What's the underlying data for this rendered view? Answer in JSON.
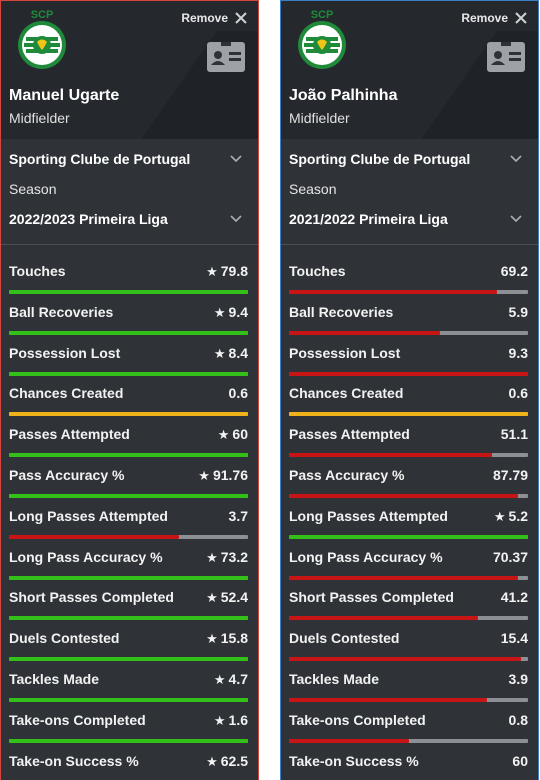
{
  "colors": {
    "green": "#33c019",
    "red": "#c71414",
    "yellow": "#f0b21a",
    "gray_track": "#8c8f93",
    "left_border": "#d8453e",
    "right_border": "#3d7fc4"
  },
  "players": [
    {
      "remove_label": "Remove",
      "logo_icon": "sporting-cp-crest-icon",
      "name": "Manuel Ugarte",
      "position": "Midfielder",
      "club": "Sporting Clube de Portugal",
      "season_label": "Season",
      "season": "2022/2023 Primeira Liga",
      "stats": [
        {
          "label": "Touches",
          "value": "79.8",
          "star": true,
          "fill": 1.0,
          "color": "green"
        },
        {
          "label": "Ball Recoveries",
          "value": "9.4",
          "star": true,
          "fill": 1.0,
          "color": "green"
        },
        {
          "label": "Possession Lost",
          "value": "8.4",
          "star": true,
          "fill": 1.0,
          "color": "green"
        },
        {
          "label": "Chances Created",
          "value": "0.6",
          "star": false,
          "fill": 1.0,
          "color": "yellow"
        },
        {
          "label": "Passes Attempted",
          "value": "60",
          "star": true,
          "fill": 1.0,
          "color": "green"
        },
        {
          "label": "Pass Accuracy %",
          "value": "91.76",
          "star": true,
          "fill": 1.0,
          "color": "green"
        },
        {
          "label": "Long Passes Attempted",
          "value": "3.7",
          "star": false,
          "fill": 0.71,
          "color": "red"
        },
        {
          "label": "Long Pass Accuracy %",
          "value": "73.2",
          "star": true,
          "fill": 1.0,
          "color": "green"
        },
        {
          "label": "Short Passes Completed",
          "value": "52.4",
          "star": true,
          "fill": 1.0,
          "color": "green"
        },
        {
          "label": "Duels Contested",
          "value": "15.8",
          "star": true,
          "fill": 1.0,
          "color": "green"
        },
        {
          "label": "Tackles Made",
          "value": "4.7",
          "star": true,
          "fill": 1.0,
          "color": "green"
        },
        {
          "label": "Take-ons Completed",
          "value": "1.6",
          "star": true,
          "fill": 1.0,
          "color": "green"
        },
        {
          "label": "Take-on Success %",
          "value": "62.5",
          "star": true,
          "fill": 1.0,
          "color": "green"
        }
      ]
    },
    {
      "remove_label": "Remove",
      "logo_icon": "sporting-cp-crest-icon",
      "name": "João Palhinha",
      "position": "Midfielder",
      "club": "Sporting Clube de Portugal",
      "season_label": "Season",
      "season": "2021/2022 Primeira Liga",
      "stats": [
        {
          "label": "Touches",
          "value": "69.2",
          "star": false,
          "fill": 0.87,
          "color": "red"
        },
        {
          "label": "Ball Recoveries",
          "value": "5.9",
          "star": false,
          "fill": 0.63,
          "color": "red"
        },
        {
          "label": "Possession Lost",
          "value": "9.3",
          "star": false,
          "fill": 1.0,
          "color": "red"
        },
        {
          "label": "Chances Created",
          "value": "0.6",
          "star": false,
          "fill": 1.0,
          "color": "yellow"
        },
        {
          "label": "Passes Attempted",
          "value": "51.1",
          "star": false,
          "fill": 0.85,
          "color": "red"
        },
        {
          "label": "Pass Accuracy %",
          "value": "87.79",
          "star": false,
          "fill": 0.96,
          "color": "red"
        },
        {
          "label": "Long Passes Attempted",
          "value": "5.2",
          "star": true,
          "fill": 1.0,
          "color": "green"
        },
        {
          "label": "Long Pass Accuracy %",
          "value": "70.37",
          "star": false,
          "fill": 0.96,
          "color": "red"
        },
        {
          "label": "Short Passes Completed",
          "value": "41.2",
          "star": false,
          "fill": 0.79,
          "color": "red"
        },
        {
          "label": "Duels Contested",
          "value": "15.4",
          "star": false,
          "fill": 0.97,
          "color": "red"
        },
        {
          "label": "Tackles Made",
          "value": "3.9",
          "star": false,
          "fill": 0.83,
          "color": "red"
        },
        {
          "label": "Take-ons Completed",
          "value": "0.8",
          "star": false,
          "fill": 0.5,
          "color": "red"
        },
        {
          "label": "Take-on Success %",
          "value": "60",
          "star": false,
          "fill": 0.96,
          "color": "red"
        }
      ]
    }
  ]
}
